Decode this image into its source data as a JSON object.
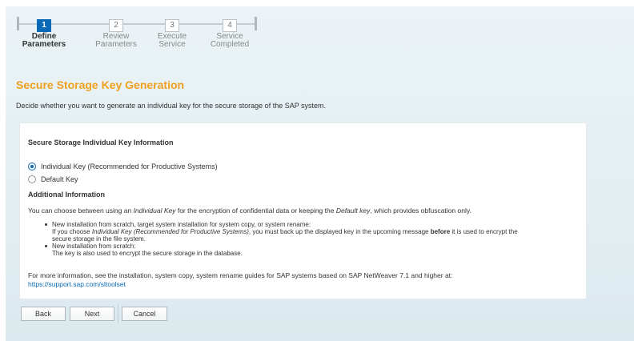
{
  "roadmap": {
    "steps": [
      {
        "number": "1",
        "line1": "Define",
        "line2": "Parameters",
        "active": true
      },
      {
        "number": "2",
        "line1": "Review",
        "line2": "Parameters",
        "active": false
      },
      {
        "number": "3",
        "line1": "Execute",
        "line2": "Service",
        "active": false
      },
      {
        "number": "4",
        "line1": "Service",
        "line2": "Completed",
        "active": false
      }
    ]
  },
  "header": {
    "title": "Secure Storage Key Generation",
    "subtitle": "Decide whether you want to generate an individual key for the secure storage of the SAP system."
  },
  "panel": {
    "section_title": "Secure Storage Individual Key Information",
    "options": [
      {
        "label": "Individual Key (Recommended for Productive Systems)",
        "selected": true
      },
      {
        "label": "Default Key",
        "selected": false
      }
    ],
    "additional_title": "Additional Information",
    "intro": {
      "part1": "You can choose between using an ",
      "em1": "Individual Key",
      "part2": " for the encryption of confidential data or keeping the ",
      "em2": "Default key",
      "part3": ", which provides obfuscation only."
    },
    "bullets": [
      {
        "head": "New installation from scratch, target system installation for system copy, or system rename:",
        "detail_part1": "If you choose ",
        "detail_em": "Individual Key (Recommended for Productive Systems)",
        "detail_part2": ", you must back up the displayed key in the upcoming message ",
        "detail_bold": "before",
        "detail_part3": " it is used to encrypt the",
        "detail_line2": "secure storage in the file system."
      },
      {
        "head": "New installation from scratch:",
        "detail": "The key is also used to encrypt the secure storage in the database."
      }
    ],
    "more_info": "For more information, see the installation, system copy, system rename guides for SAP systems based on SAP NetWeaver 7.1 and higher at:",
    "link": "https://support.sap.com/sltoolset"
  },
  "buttons": {
    "back": "Back",
    "next": "Next",
    "cancel": "Cancel"
  },
  "colors": {
    "accent": "#0a6ab7",
    "title": "#f0a020"
  }
}
